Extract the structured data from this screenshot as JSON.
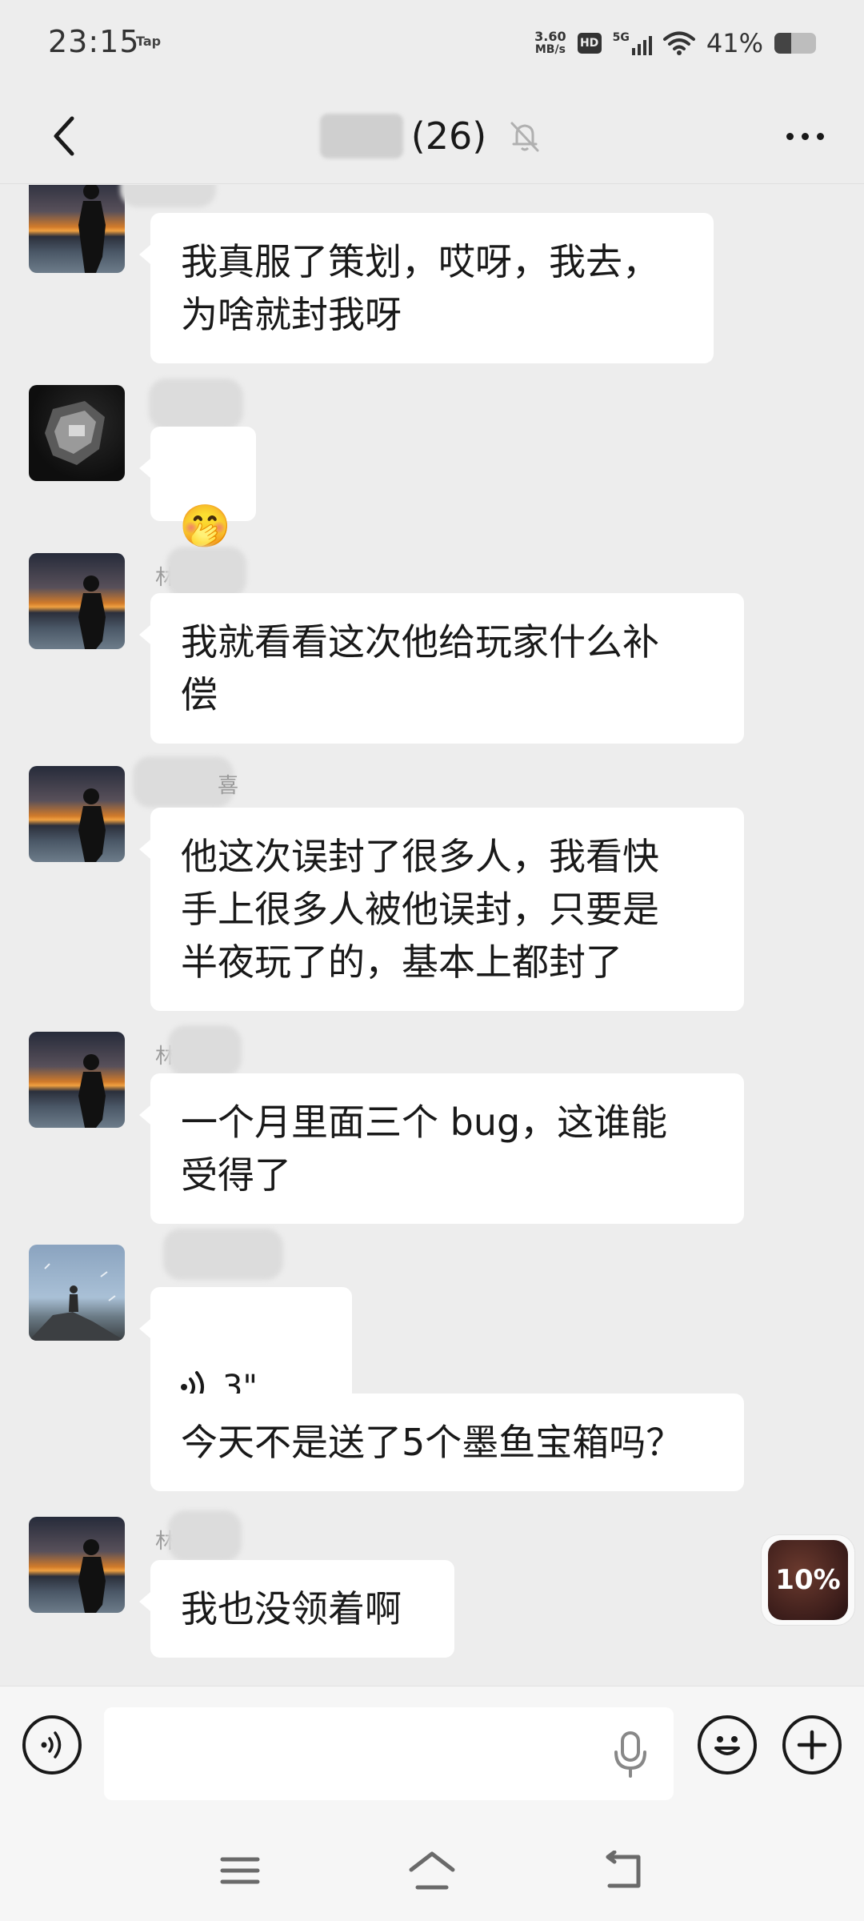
{
  "status_bar": {
    "time": "23:15",
    "tap_label": "Tap",
    "net_speed_value": "3.60",
    "net_speed_unit": "MB/s",
    "hd_label": "HD",
    "network_label": "5G",
    "battery_percent_text": "41%",
    "battery_level": 0.41
  },
  "header": {
    "member_count": "(26)",
    "icons": {
      "back": "chevron-left-icon",
      "mute": "bell-off-icon",
      "more": "more-dots-icon"
    }
  },
  "messages": [
    {
      "avatar": "sunset-silhouette",
      "text": "我真服了策划，哎呀，我去，\n为啥就封我呀"
    },
    {
      "avatar": "mech-robot",
      "emoji": "🤭"
    },
    {
      "avatar": "sunset-silhouette",
      "text": "我就看看这次他给玩家什么补\n偿"
    },
    {
      "avatar": "sunset-silhouette",
      "text": "他这次误封了很多人，我看快\n手上很多人被他误封，只要是\n半夜玩了的，基本上都封了"
    },
    {
      "avatar": "sunset-silhouette",
      "text": "一个月里面三个 bug，这谁能\n受得了"
    },
    {
      "avatar": "cliff-figure",
      "voice_duration": "3\"",
      "text": "今天不是送了5个墨鱼宝箱吗？"
    },
    {
      "avatar": "sunset-silhouette",
      "text": "我也没领着啊"
    }
  ],
  "name_fragments": [
    "林",
    "喜"
  ],
  "floating_task": {
    "progress_text": "10%",
    "progress": 0.1
  },
  "input_bar": {
    "placeholder": "",
    "icons": {
      "voice": "voice-wave-icon",
      "mic": "microphone-icon",
      "emoji": "smiley-icon",
      "plus": "plus-circle-icon"
    }
  },
  "system_nav": {
    "icons": {
      "menu": "menu-lines-icon",
      "home": "home-icon",
      "back": "back-arrow-icon"
    }
  },
  "colors": {
    "background": "#ededed",
    "bubble": "#ffffff",
    "text": "#191919",
    "bar": "#f6f6f6"
  }
}
